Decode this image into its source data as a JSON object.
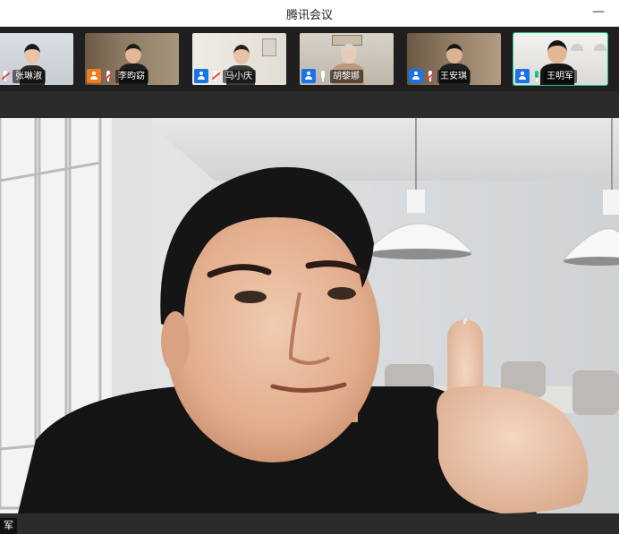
{
  "window": {
    "title": "腾讯会议",
    "minimize_glyph": "—"
  },
  "participants": [
    {
      "name": "张琳淑",
      "badge": "none",
      "badge_color": "",
      "mic": "muted",
      "active": false
    },
    {
      "name": "李昀窈",
      "badge": "user-icon",
      "badge_color": "#f07b1a",
      "mic": "muted",
      "active": false
    },
    {
      "name": "马小庆",
      "badge": "user-icon",
      "badge_color": "#1a73e8",
      "mic": "muted",
      "active": false
    },
    {
      "name": "胡黎娜",
      "badge": "user-icon",
      "badge_color": "#1a73e8",
      "mic": "on-idle",
      "active": false
    },
    {
      "name": "王安琪",
      "badge": "user-icon",
      "badge_color": "#1a73e8",
      "mic": "muted",
      "active": false
    },
    {
      "name": "王明军",
      "badge": "user-icon",
      "badge_color": "#1a73e8",
      "mic": "speaking",
      "active": true
    }
  ],
  "main_speaker": {
    "tag": "军"
  },
  "colors": {
    "active_outline": "#19c37d",
    "muted_mic": "#e54545"
  }
}
